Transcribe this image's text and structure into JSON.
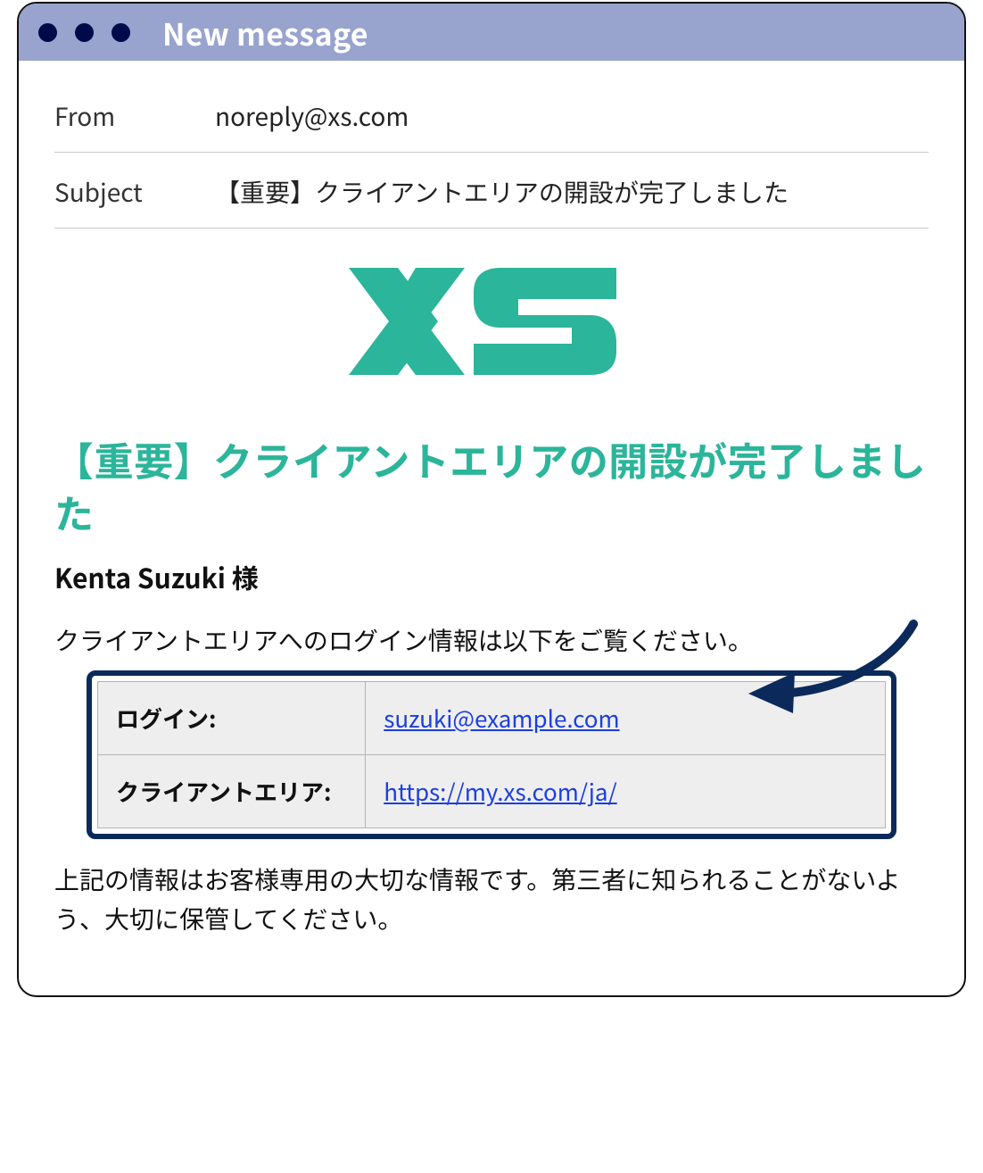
{
  "window": {
    "title": "New message"
  },
  "headers": {
    "from_label": "From",
    "from_value": "noreply@xs.com",
    "subject_label": "Subject",
    "subject_value": "【重要】クライアントエリアの開設が完了しました"
  },
  "body": {
    "heading": "【重要】クライアントエリアの開設が完了しました",
    "salutation": "Kenta Suzuki 様",
    "intro": "クライアントエリアへのログイン情報は以下をご覧ください。",
    "login_table": {
      "row1_label": "ログイン:",
      "row1_value": "suzuki@example.com",
      "row2_label": "クライアントエリア:",
      "row2_value": "https://my.xs.com/ja/"
    },
    "footer_note": "上記の情報はお客様専用の大切な情報です。第三者に知られることがないよう、大切に保管してください。"
  },
  "colors": {
    "accent_green": "#2bb59a",
    "titlebar": "#98a3ce",
    "box_border": "#0b2a5b",
    "link": "#1a3fe0"
  }
}
